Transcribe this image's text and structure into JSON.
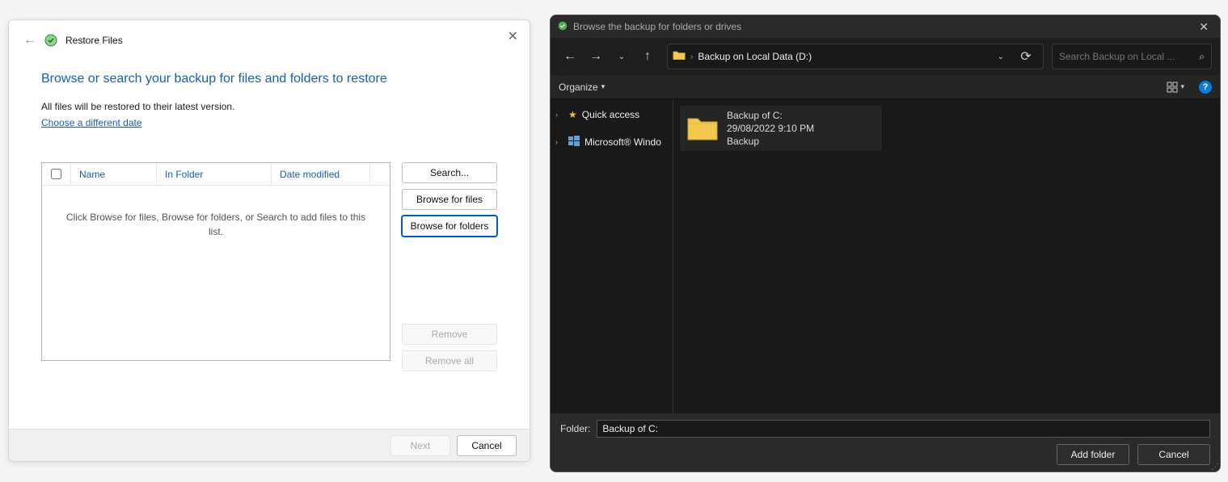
{
  "restore": {
    "window_title": "Restore Files",
    "heading": "Browse or search your backup for files and folders to restore",
    "sub1": "All files will be restored to their latest version.",
    "link": "Choose a different date",
    "columns": {
      "name": "Name",
      "in_folder": "In Folder",
      "date_modified": "Date modified"
    },
    "empty_hint": "Click Browse for files, Browse for folders, or Search to add files to this list.",
    "buttons": {
      "search": "Search...",
      "browse_files": "Browse for files",
      "browse_folders": "Browse for folders",
      "remove": "Remove",
      "remove_all": "Remove all"
    },
    "footer": {
      "next": "Next",
      "cancel": "Cancel"
    }
  },
  "browse": {
    "title": "Browse the backup for folders or drives",
    "address": "Backup on Local Data (D:)",
    "search_placeholder": "Search Backup on Local ...",
    "organize": "Organize",
    "tree": {
      "quick_access": "Quick access",
      "ms_windows": "Microsoft® Windo"
    },
    "item": {
      "name": "Backup of C:",
      "date": "29/08/2022 9:10 PM",
      "type": "Backup"
    },
    "footer": {
      "folder_label": "Folder:",
      "folder_value": "Backup of C:",
      "add": "Add folder",
      "cancel": "Cancel"
    }
  }
}
